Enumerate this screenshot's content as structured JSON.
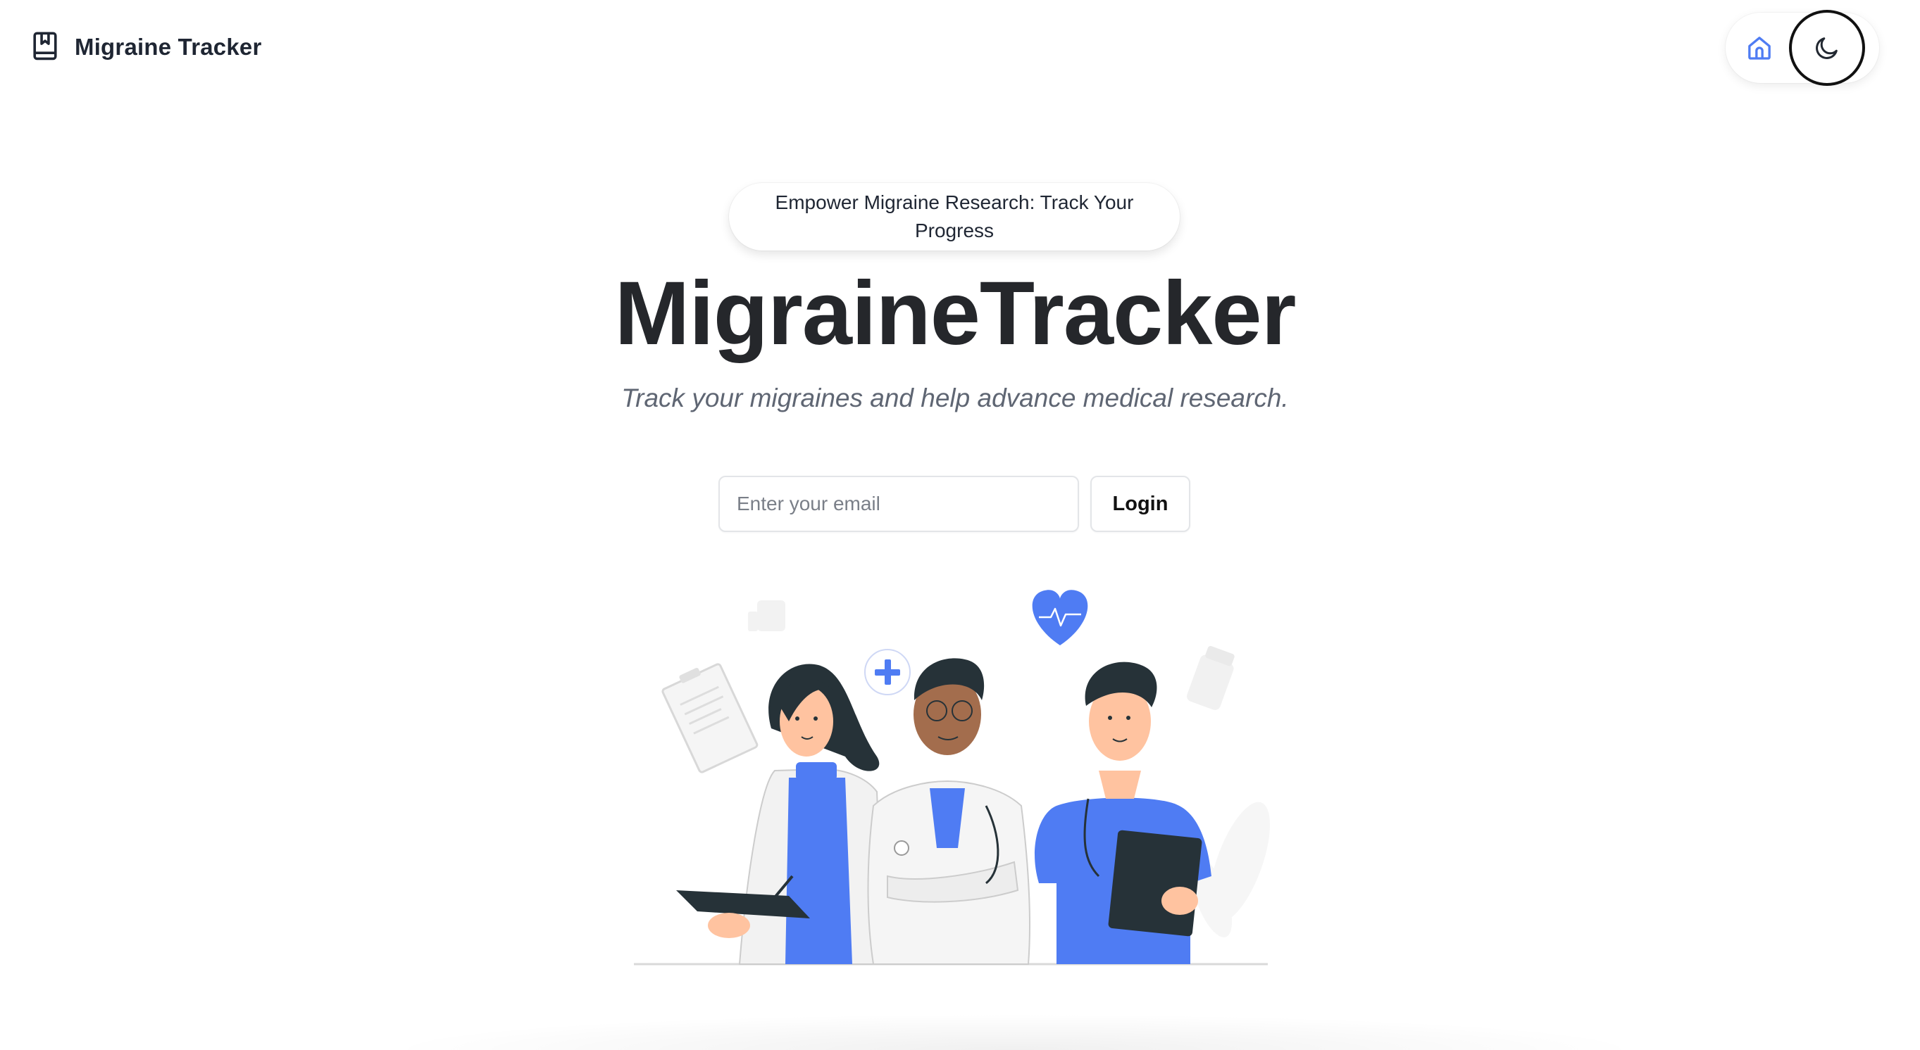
{
  "header": {
    "brand_name": "Migraine Tracker",
    "brand_icon": "bookmark-book-icon",
    "nav": {
      "home_icon": "home-icon",
      "theme_icon": "moon-icon"
    }
  },
  "hero": {
    "badge_text": "Empower Migraine Research: Track Your Progress",
    "title": "MigraineTracker",
    "subtitle": "Track your migraines and help advance medical research.",
    "email_placeholder": "Enter your email",
    "email_value": "",
    "login_label": "Login"
  },
  "illustration": {
    "name": "doctors-team-illustration"
  },
  "colors": {
    "accent": "#4f7cf3",
    "text": "#25272b",
    "muted": "#5f6673"
  }
}
